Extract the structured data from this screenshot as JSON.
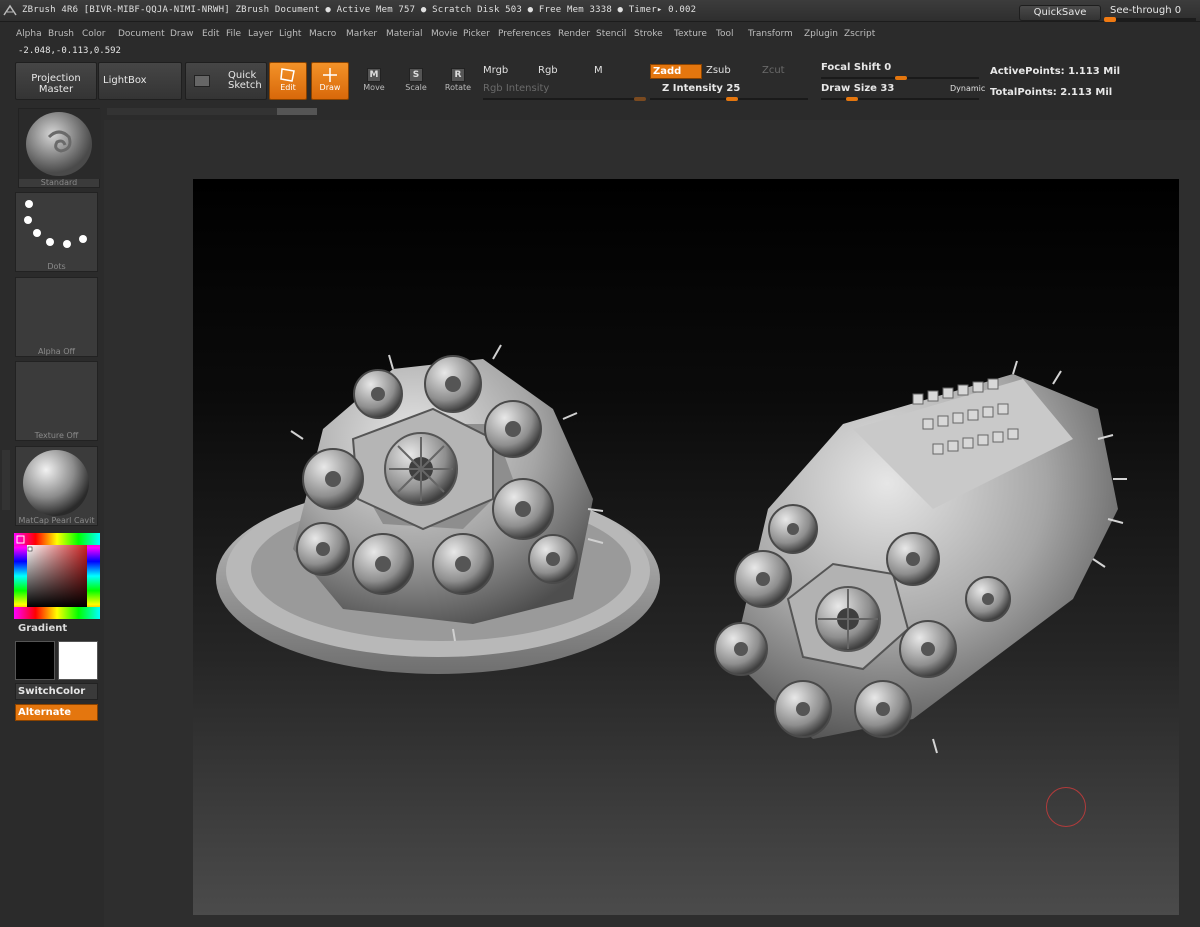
{
  "title_bar": {
    "title": "ZBrush 4R6 [BIVR-MIBF-QQJA-NIMI-NRWH]   ZBrush Document    ● Active Mem 757 ● Scratch Disk 503 ● Free Mem 3338 ● Timer▸ 0.002",
    "quicksave": "QuickSave",
    "see_through": "See-through",
    "see_through_value": "0"
  },
  "menu": [
    "Alpha",
    "Brush",
    "Color",
    "Document",
    "Draw",
    "Edit",
    "File",
    "Layer",
    "Light",
    "Macro",
    "Marker",
    "Material",
    "Movie",
    "Picker",
    "Preferences",
    "Render",
    "Stencil",
    "Stroke",
    "Texture",
    "Tool",
    "Transform",
    "Zplugin",
    "Zscript"
  ],
  "coordinates": "-2.048,-0.113,0.592",
  "toolbar": {
    "projection_master": "Projection Master",
    "lightbox": "LightBox",
    "quick_sketch": "Quick Sketch",
    "edit": "Edit",
    "draw": "Draw",
    "move": "Move",
    "scale": "Scale",
    "rotate": "Rotate",
    "mrgb": "Mrgb",
    "rgb": "Rgb",
    "m": "M",
    "rgb_intensity": "Rgb Intensity",
    "zadd": "Zadd",
    "zsub": "Zsub",
    "zcut": "Zcut",
    "z_intensity": "Z Intensity 25",
    "focal_shift": "Focal Shift 0",
    "draw_size": "Draw Size 33",
    "dynamic": "Dynamic",
    "active_points": "ActivePoints: 1.113 Mil",
    "total_points": "TotalPoints: 2.113 Mil"
  },
  "shelf": {
    "brush": "Standard",
    "stroke": "Dots",
    "alpha": "Alpha Off",
    "texture": "Texture Off",
    "material": "MatCap Pearl Cavit",
    "gradient": "Gradient",
    "switch_color": "SwitchColor",
    "alternate": "Alternate"
  },
  "colors": {
    "accent": "#e4760e",
    "background": "#2b2b2b"
  }
}
